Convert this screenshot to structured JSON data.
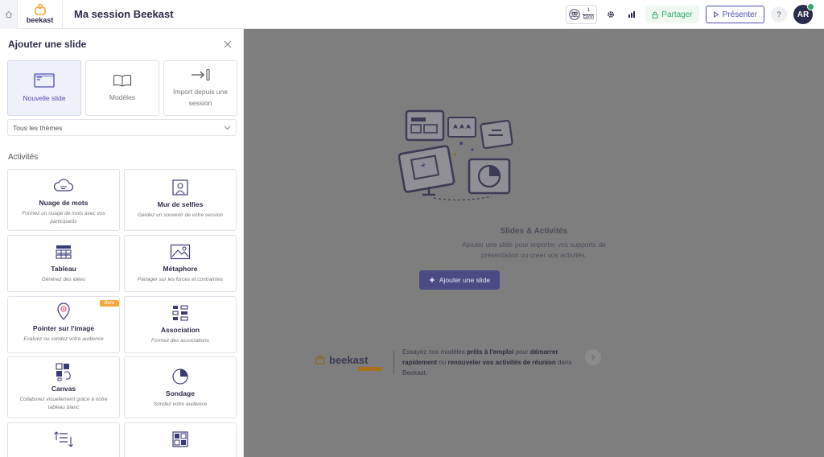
{
  "header": {
    "logo_text": "beekast",
    "session_title": "Ma session Beekast",
    "users_current": "1",
    "users_max": "5000",
    "share_label": "Partager",
    "present_label": "Présenter",
    "help_label": "?",
    "avatar_initials": "AR"
  },
  "panel": {
    "title": "Ajouter une slide",
    "modes": [
      {
        "label": "Nouvelle slide"
      },
      {
        "label": "Modèles"
      },
      {
        "label": "Import depuis une session"
      }
    ],
    "theme_select": "Tous les thèmes",
    "section": "Activités",
    "activities": [
      {
        "title": "Nuage de mots",
        "desc": "Formez un nuage de mots avec vos participants"
      },
      {
        "title": "Mur de selfies",
        "desc": "Gardez un souvenir de votre session"
      },
      {
        "title": "Tableau",
        "desc": "Générez des idées"
      },
      {
        "title": "Métaphore",
        "desc": "Partager sur les forces et contraintes"
      },
      {
        "title": "Pointer sur l'image",
        "desc": "Evaluez ou sondez votre audience",
        "badge": "Beta"
      },
      {
        "title": "Association",
        "desc": "Formez des associations"
      },
      {
        "title": "Canvas",
        "desc": "Collaborez visuellement grâce à notre tableau blanc"
      },
      {
        "title": "Sondage",
        "desc": "Sondez votre audience"
      }
    ]
  },
  "main": {
    "empty_title": "Slides & Activités",
    "empty_desc_1": "Ajouter une slide pour importer vos supports de",
    "empty_desc_2": "présentation ou créer vos activités.",
    "add_slide_label": "Ajouter une slide",
    "promo_logo": "beekast",
    "promo_1": "Essayez nos modèles ",
    "promo_2": "prêts à l'emploi",
    "promo_3": " pour ",
    "promo_4": "démarrer rapidement",
    "promo_5": " ou ",
    "promo_6": "renouveler vos activités de réunion",
    "promo_7": " dans Beekast."
  },
  "colors": {
    "accent": "#4f4fb0",
    "share_green": "#2fa86b",
    "beta_orange": "#f5a43a",
    "overlay": "#7e7e7e"
  }
}
